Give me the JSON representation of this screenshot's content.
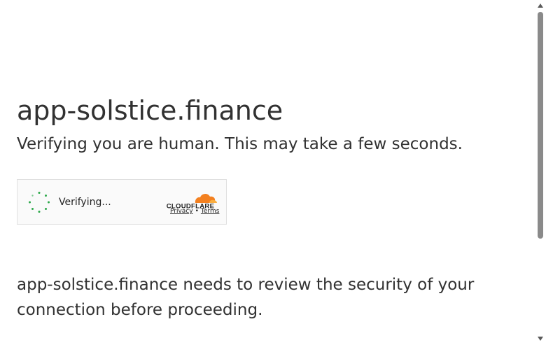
{
  "page": {
    "site_name": "app-solstice.finance",
    "subtitle": "Verifying you are human. This may take a few seconds.",
    "review_message": "app-solstice.finance needs to review the security of your connection before proceeding."
  },
  "widget": {
    "status_text": "Verifying...",
    "brand_text": "CLOUDFLARE",
    "privacy_link": "Privacy",
    "separator": "•",
    "terms_link": "Terms",
    "spinner_color": "#2ca94a",
    "brand_color": "#f38020"
  },
  "icons": {
    "spinner": "loading-spinner-icon",
    "brand": "cloudflare-logo",
    "scroll_up": "scroll-up-arrow-icon",
    "scroll_down": "scroll-down-arrow-icon"
  }
}
